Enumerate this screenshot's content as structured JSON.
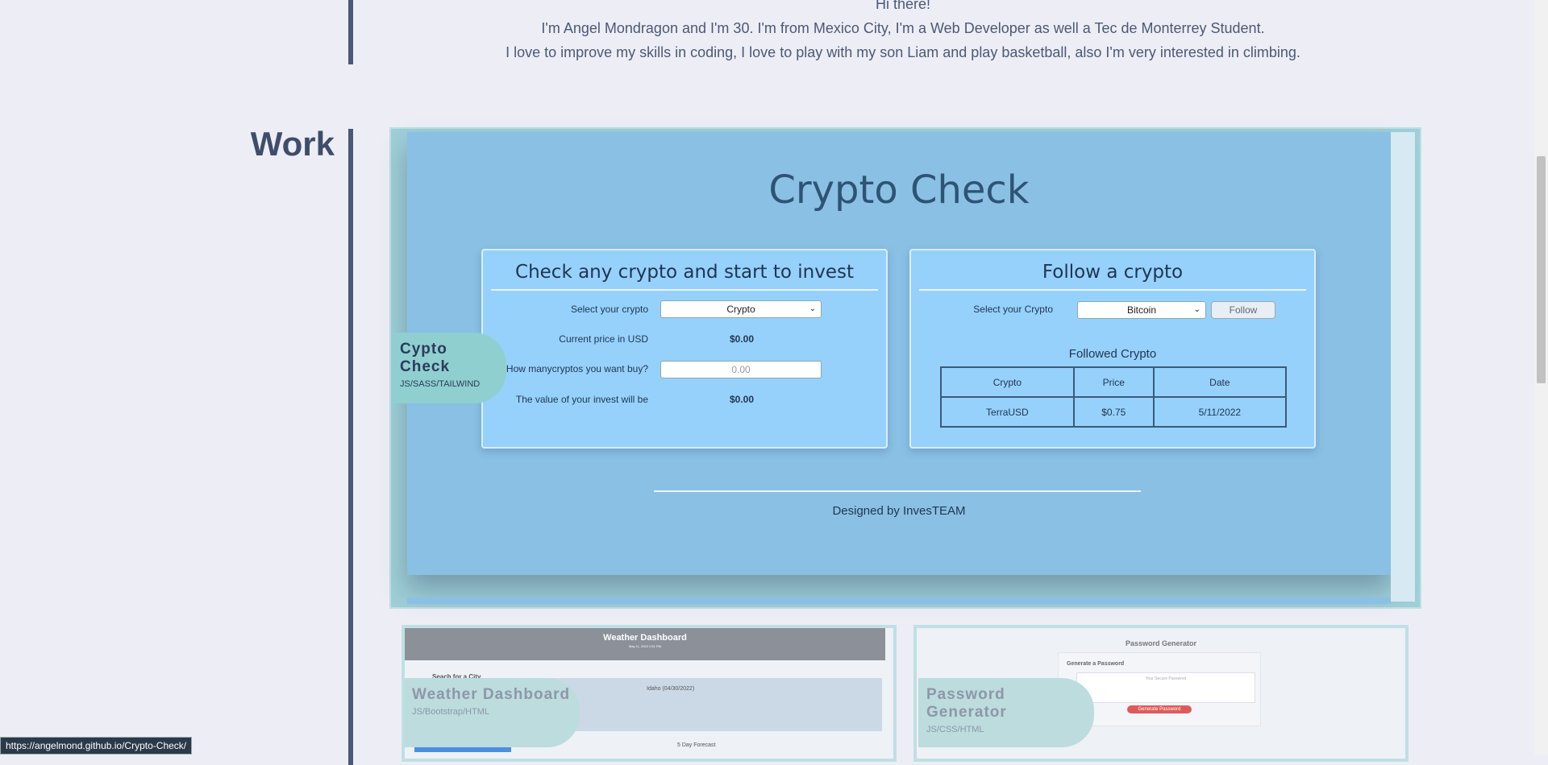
{
  "about": {
    "greeting": "Hi there!",
    "line1": "I'm Angel Mondragon and I'm 30. I'm from Mexico City, I'm a Web Developer as well a Tec de Monterrey Student.",
    "line2": "I love to improve my skills in coding, I love to play with my son Liam and play basketball, also I'm very interested in climbing."
  },
  "work": {
    "title": "Work",
    "main_project": {
      "name": "Cypto Check",
      "tech": "JS/SASS/TAILWIND",
      "screenshot": {
        "app_title": "Crypto Check",
        "left_panel": {
          "heading": "Check any crypto and start to invest",
          "select_label": "Select your crypto",
          "select_value": "Crypto",
          "price_label": "Current price in USD",
          "price_value": "$0.00",
          "amount_label": "How manycryptos you want buy?",
          "amount_placeholder": "0.00",
          "invest_label": "The value of your invest will be",
          "invest_value": "$0.00"
        },
        "right_panel": {
          "heading": "Follow a crypto",
          "select_label": "Select your Crypto",
          "select_value": "Bitcoin",
          "follow_button": "Follow",
          "followed_title": "Followed Crypto",
          "table_headers": [
            "Crypto",
            "Price",
            "Date"
          ],
          "table_rows": [
            [
              "TerraUSD",
              "$0.75",
              "5/11/2022"
            ]
          ]
        },
        "footer": "Designed by InvesTEAM"
      }
    },
    "weather_project": {
      "name": "Weather Dashboard",
      "tech": "JS/Bootstrap/HTML",
      "preview": {
        "header": "Weather Dashboard",
        "date": "May 11, 2022 2:51 PM",
        "search_label": "Seach for a City",
        "city": "Idaho (04/30/2022)",
        "forecast": "5 Day Forecast"
      }
    },
    "password_project": {
      "name": "Password Generator",
      "tech": "JS/CSS/HTML",
      "preview": {
        "title": "Password Generator",
        "label": "Generate a Password",
        "placeholder": "Your Secure Password",
        "button": "Generate Password"
      }
    }
  },
  "status_bar": {
    "url": "https://angelmond.github.io/Crypto-Check/"
  },
  "colors": {
    "background": "#edeef5",
    "accent": "#8fcfcf",
    "card_border": "#9fcfd8",
    "crypto_bg": "#8ac0e4"
  }
}
